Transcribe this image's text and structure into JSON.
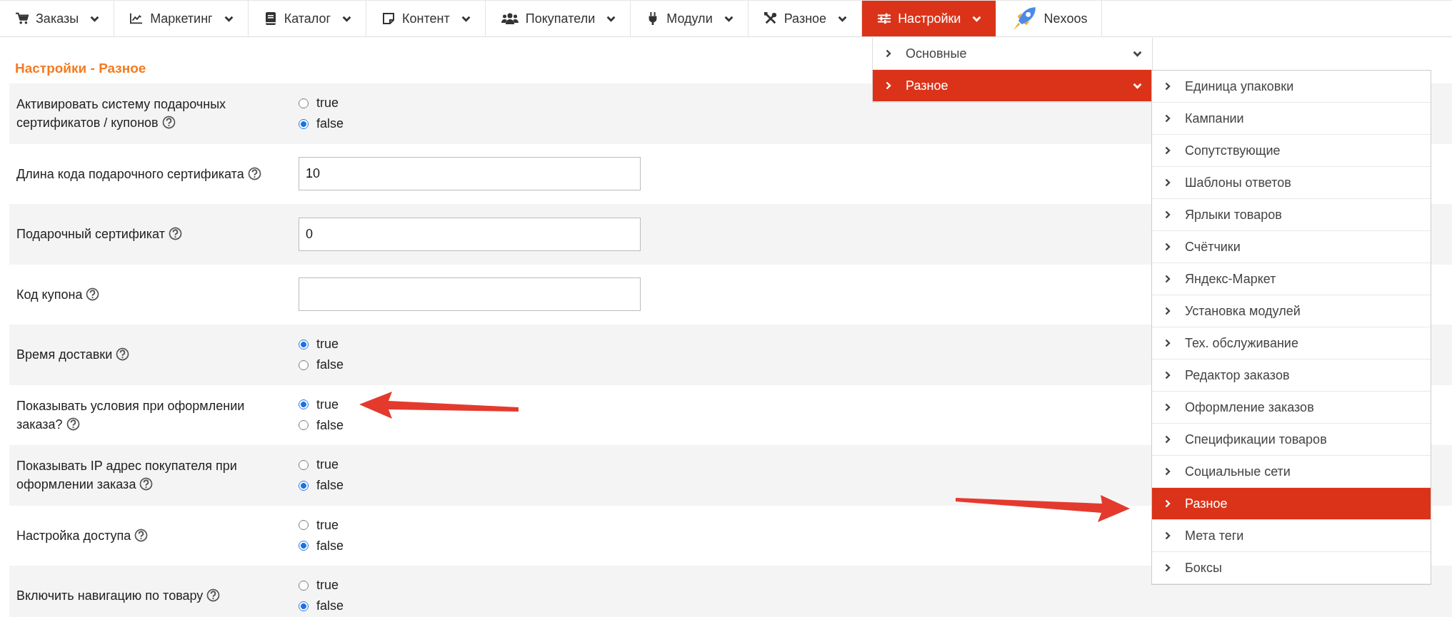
{
  "nav": [
    {
      "label": "Заказы",
      "kind": "menu",
      "selected": false
    },
    {
      "label": "Маркетинг",
      "kind": "menu",
      "selected": false
    },
    {
      "label": "Каталог",
      "kind": "menu",
      "selected": false
    },
    {
      "label": "Контент",
      "kind": "menu",
      "selected": false
    },
    {
      "label": "Покупатели",
      "kind": "menu",
      "selected": false
    },
    {
      "label": "Модули",
      "kind": "menu",
      "selected": false
    },
    {
      "label": "Разное",
      "kind": "menu",
      "selected": false
    },
    {
      "label": "Настройки",
      "kind": "menu",
      "selected": true
    },
    {
      "label": "Nexoos",
      "kind": "link",
      "selected": false
    }
  ],
  "submenu": [
    {
      "label": "Основные",
      "selected": false
    },
    {
      "label": "Разное",
      "selected": true
    }
  ],
  "submenu_2": [
    {
      "label": "Единица упаковки",
      "selected": false
    },
    {
      "label": "Кампании",
      "selected": false
    },
    {
      "label": "Сопутствующие",
      "selected": false
    },
    {
      "label": "Шаблоны ответов",
      "selected": false
    },
    {
      "label": "Ярлыки товаров",
      "selected": false
    },
    {
      "label": "Счётчики",
      "selected": false
    },
    {
      "label": "Яндекс-Маркет",
      "selected": false
    },
    {
      "label": "Установка модулей",
      "selected": false
    },
    {
      "label": "Тех. обслуживание",
      "selected": false
    },
    {
      "label": "Редактор заказов",
      "selected": false
    },
    {
      "label": "Оформление заказов",
      "selected": false
    },
    {
      "label": "Спецификации товаров",
      "selected": false
    },
    {
      "label": "Социальные сети",
      "selected": false
    },
    {
      "label": "Разное",
      "selected": true
    },
    {
      "label": "Мета теги",
      "selected": false
    },
    {
      "label": "Боксы",
      "selected": false
    }
  ],
  "page_title": "Настройки - Разное",
  "settings": [
    {
      "kind": "radio",
      "label": "Активировать систему подарочных сертификатов / купонов",
      "options": [
        {
          "label": "true",
          "selected": false
        },
        {
          "label": "false",
          "selected": true
        }
      ]
    },
    {
      "kind": "text",
      "label": "Длина кода подарочного сертификата",
      "value": "10"
    },
    {
      "kind": "text",
      "label": "Подарочный сертификат",
      "value": "0"
    },
    {
      "kind": "text",
      "label": "Код купона"
    },
    {
      "kind": "radio",
      "label": "Время доставки",
      "options": [
        {
          "label": "true",
          "selected": true
        },
        {
          "label": "false",
          "selected": false
        }
      ]
    },
    {
      "kind": "radio",
      "label": "Показывать условия при оформлении заказа?",
      "options": [
        {
          "label": "true",
          "selected": true
        },
        {
          "label": "false",
          "selected": false
        }
      ]
    },
    {
      "kind": "radio",
      "label": "Показывать IP адрес покупателя при оформлении заказа",
      "options": [
        {
          "label": "true",
          "selected": false
        },
        {
          "label": "false",
          "selected": true
        }
      ]
    },
    {
      "kind": "radio",
      "label": "Настройка доступа",
      "options": [
        {
          "label": "true",
          "selected": false
        },
        {
          "label": "false",
          "selected": true
        }
      ]
    },
    {
      "kind": "radio",
      "label": "Включить навигацию по товару",
      "options": [
        {
          "label": "true",
          "selected": false
        },
        {
          "label": "false",
          "selected": true
        }
      ]
    }
  ]
}
